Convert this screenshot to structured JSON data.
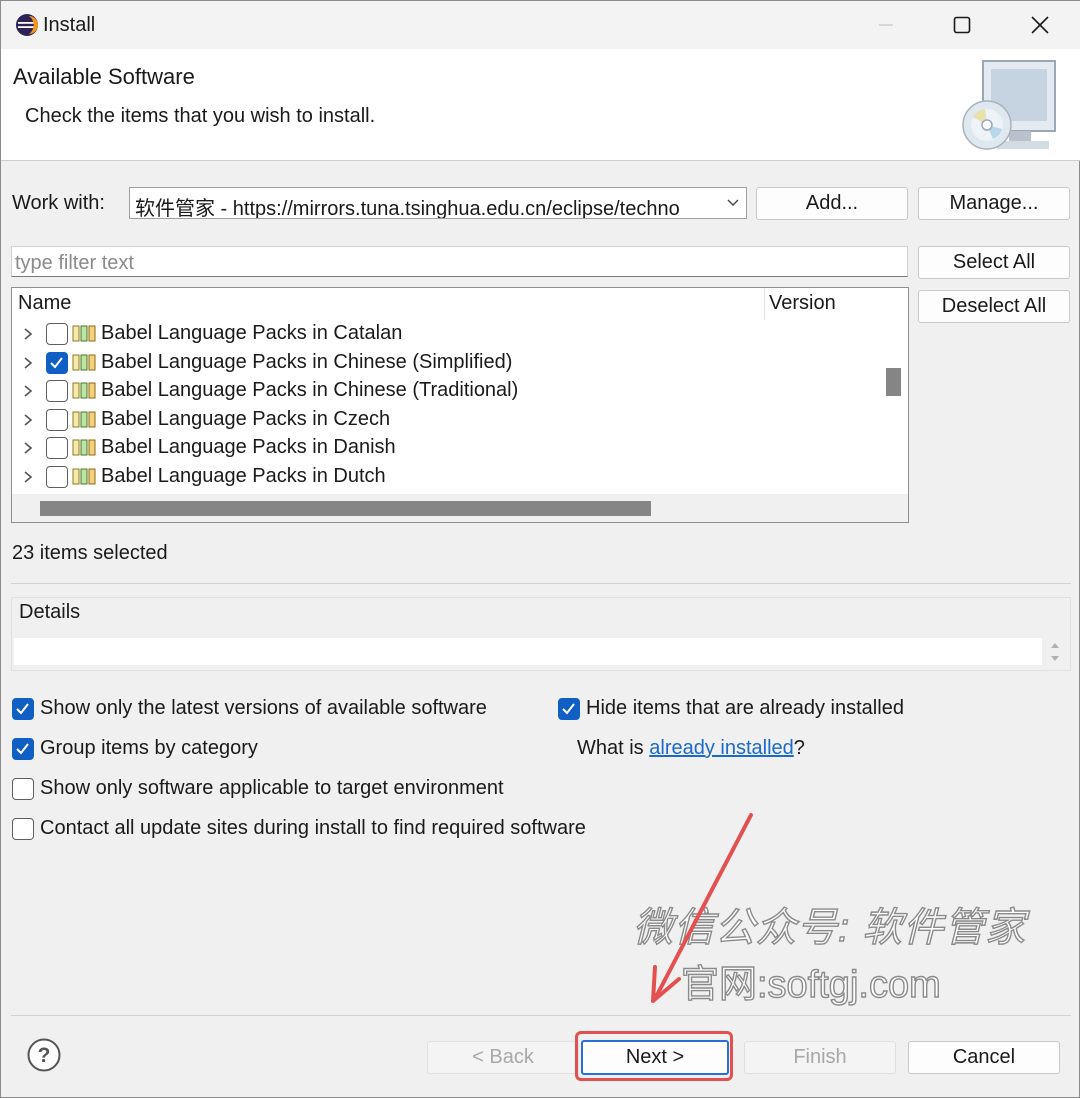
{
  "window": {
    "title": "Install"
  },
  "banner": {
    "title": "Available Software",
    "description": "Check the items that you wish to install."
  },
  "work_with": {
    "label": "Work with:",
    "value": "软件管家 - https://mirrors.tuna.tsinghua.edu.cn/eclipse/techno",
    "add_label": "Add...",
    "manage_label": "Manage..."
  },
  "filter": {
    "placeholder": "type filter text"
  },
  "side_buttons": {
    "select_all": "Select All",
    "deselect_all": "Deselect All"
  },
  "table": {
    "columns": [
      "Name",
      "Version"
    ],
    "rows": [
      {
        "label": "Babel Language Packs in Catalan",
        "checked": false
      },
      {
        "label": "Babel Language Packs in Chinese (Simplified)",
        "checked": true
      },
      {
        "label": "Babel Language Packs in Chinese (Traditional)",
        "checked": false
      },
      {
        "label": "Babel Language Packs in Czech",
        "checked": false
      },
      {
        "label": "Babel Language Packs in Danish",
        "checked": false
      },
      {
        "label": "Babel Language Packs in Dutch",
        "checked": false
      }
    ]
  },
  "status": {
    "selected_count": "23 items selected"
  },
  "details": {
    "label": "Details"
  },
  "options": {
    "latest_versions": {
      "label": "Show only the latest versions of available software",
      "checked": true
    },
    "hide_installed": {
      "label": "Hide items that are already installed",
      "checked": true
    },
    "group_by_category": {
      "label": "Group items by category",
      "checked": true
    },
    "what_is_prefix": "What is ",
    "what_is_link": "already installed",
    "what_is_suffix": "?",
    "target_env": {
      "label": "Show only software applicable to target environment",
      "checked": false
    },
    "contact_sites": {
      "label": "Contact all update sites during install to find required software",
      "checked": false
    }
  },
  "watermark": {
    "line1": "微信公众号: 软件管家",
    "line2": "官网:softgj.com"
  },
  "footer": {
    "back": "< Back",
    "next": "Next >",
    "finish": "Finish",
    "cancel": "Cancel"
  },
  "colors": {
    "accent": "#0f5fc4",
    "link": "#1a6ac8",
    "highlight": "#e4504f"
  }
}
